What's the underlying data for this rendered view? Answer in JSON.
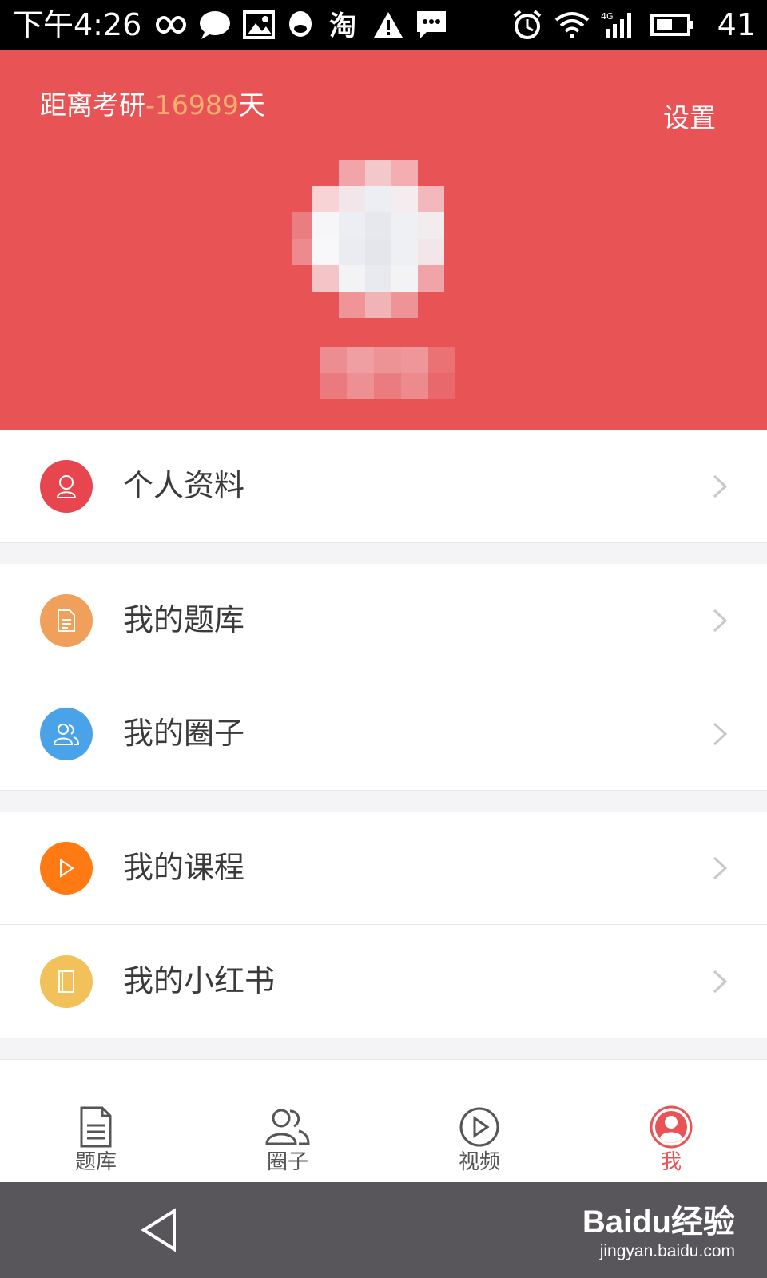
{
  "status_bar": {
    "time": "下午4:26",
    "battery": "41",
    "icons": [
      "infinity-icon",
      "chat-bubble-icon",
      "image-icon",
      "qq-icon",
      "taobao-icon",
      "warning-icon",
      "sms-icon",
      "alarm-icon",
      "wifi-icon",
      "signal-4g-icon",
      "battery-icon"
    ]
  },
  "header": {
    "countdown_prefix": "距离考研",
    "countdown_days": "-16989",
    "countdown_suffix": "天",
    "settings_label": "设置",
    "colors": {
      "background": "#e85455",
      "days": "#ffb070"
    }
  },
  "menu": {
    "items": [
      {
        "label": "个人资料",
        "icon": "person-icon",
        "color": "#e8464e"
      },
      {
        "label": "我的题库",
        "icon": "document-icon",
        "color": "#f0a05a"
      },
      {
        "label": "我的圈子",
        "icon": "group-icon",
        "color": "#4aa3e8"
      },
      {
        "label": "我的课程",
        "icon": "play-icon",
        "color": "#ff7a12"
      },
      {
        "label": "我的小红书",
        "icon": "book-icon",
        "color": "#f2c15a"
      }
    ]
  },
  "tabs": [
    {
      "label": "题库",
      "icon": "document-icon",
      "active": false
    },
    {
      "label": "圈子",
      "icon": "group-icon",
      "active": false
    },
    {
      "label": "视频",
      "icon": "play-circle-icon",
      "active": false
    },
    {
      "label": "我",
      "icon": "user-avatar-icon",
      "active": true
    }
  ],
  "watermark": {
    "logo": "Baidu经验",
    "url": "jingyan.baidu.com"
  }
}
